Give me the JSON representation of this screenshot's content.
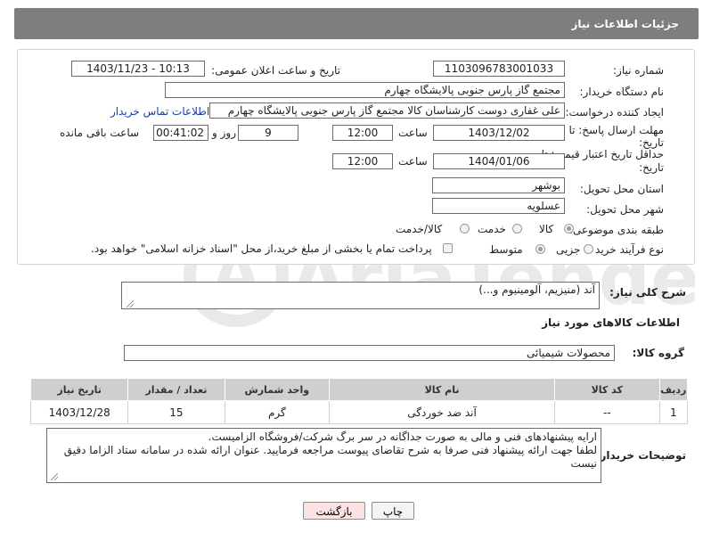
{
  "header": {
    "title": "جزئیات اطلاعات نیاز"
  },
  "fields": {
    "need_number_label": "شماره نیاز:",
    "need_number": "1103096783001033",
    "announce_label": "تاریخ و ساعت اعلان عمومی:",
    "announce_value": "1403/11/23 - 10:13",
    "buyer_org_label": "نام دستگاه خریدار:",
    "buyer_org": "مجتمع گاز پارس جنوبی  پالایشگاه چهارم",
    "creator_label": "ایجاد کننده درخواست:",
    "creator": "علی غفاری دوست کارشناسان کالا مجتمع گاز پارس جنوبی  پالایشگاه چهارم",
    "contact_link": "اطلاعات تماس خریدار",
    "deadline_label_1": "مهلت ارسال پاسخ: تا",
    "deadline_label_2": "تاریخ:",
    "deadline_date": "1403/12/02",
    "time_label": "ساعت",
    "deadline_time": "12:00",
    "days_value": "9",
    "days_label": "روز و",
    "remaining_time": "00:41:02",
    "remaining_label": "ساعت باقی مانده",
    "validity_label_1": "حداقل تاریخ اعتبار قیمت: تا",
    "validity_label_2": "تاریخ:",
    "validity_date": "1404/01/06",
    "validity_time": "12:00",
    "province_label": "استان محل تحویل:",
    "province": "بوشهر",
    "city_label": "شهر محل تحویل:",
    "city": "عسلویه",
    "category_label": "طبقه بندی موضوعی:",
    "category_options": [
      "کالا",
      "خدمت",
      "کالا/خدمت"
    ],
    "process_label": "نوع فرآیند خرید :",
    "process_options": [
      "جزیی",
      "متوسط"
    ],
    "payment_note": "پرداخت تمام یا بخشی از مبلغ خرید،از محل \"اسناد خزانه اسلامی\" خواهد بود."
  },
  "description": {
    "label": "شرح کلی نیاز:",
    "value": "آند (منیزیم، آلومینیوم و...)"
  },
  "goods_section": {
    "title": "اطلاعات کالاهای مورد نیاز",
    "group_label": "گروه کالا:",
    "group_value": "محصولات شیمیائی"
  },
  "table": {
    "headers": [
      "ردیف",
      "کد کالا",
      "نام کالا",
      "واحد شمارش",
      "تعداد / مقدار",
      "تاریخ نیاز"
    ],
    "rows": [
      [
        "1",
        "--",
        "آند ضد خوردگی",
        "گرم",
        "15",
        "1403/12/28"
      ]
    ]
  },
  "buyer_notes": {
    "label": "توضیحات خریدار:",
    "lines": [
      "ارایه پیشنهادهای فنی و مالی به صورت جداگانه در سر برگ شرکت/فروشگاه الزامیست.",
      "لطفا جهت ارائه پیشنهاد فنی صرفا به شرح تقاضای پیوست مراجعه فرمایید. عنوان ارائه شده در سامانه ستاد الزاما دقیق",
      "نیست"
    ]
  },
  "buttons": {
    "print": "چاپ",
    "back": "بازگشت"
  },
  "watermark": {
    "text": "AriaTender.neT"
  },
  "colors": {
    "header_bg": "#7e7e7e",
    "table_header_bg": "#cfcfcf",
    "back_button_bg": "#fbe3e3",
    "link": "#1a3da8"
  }
}
